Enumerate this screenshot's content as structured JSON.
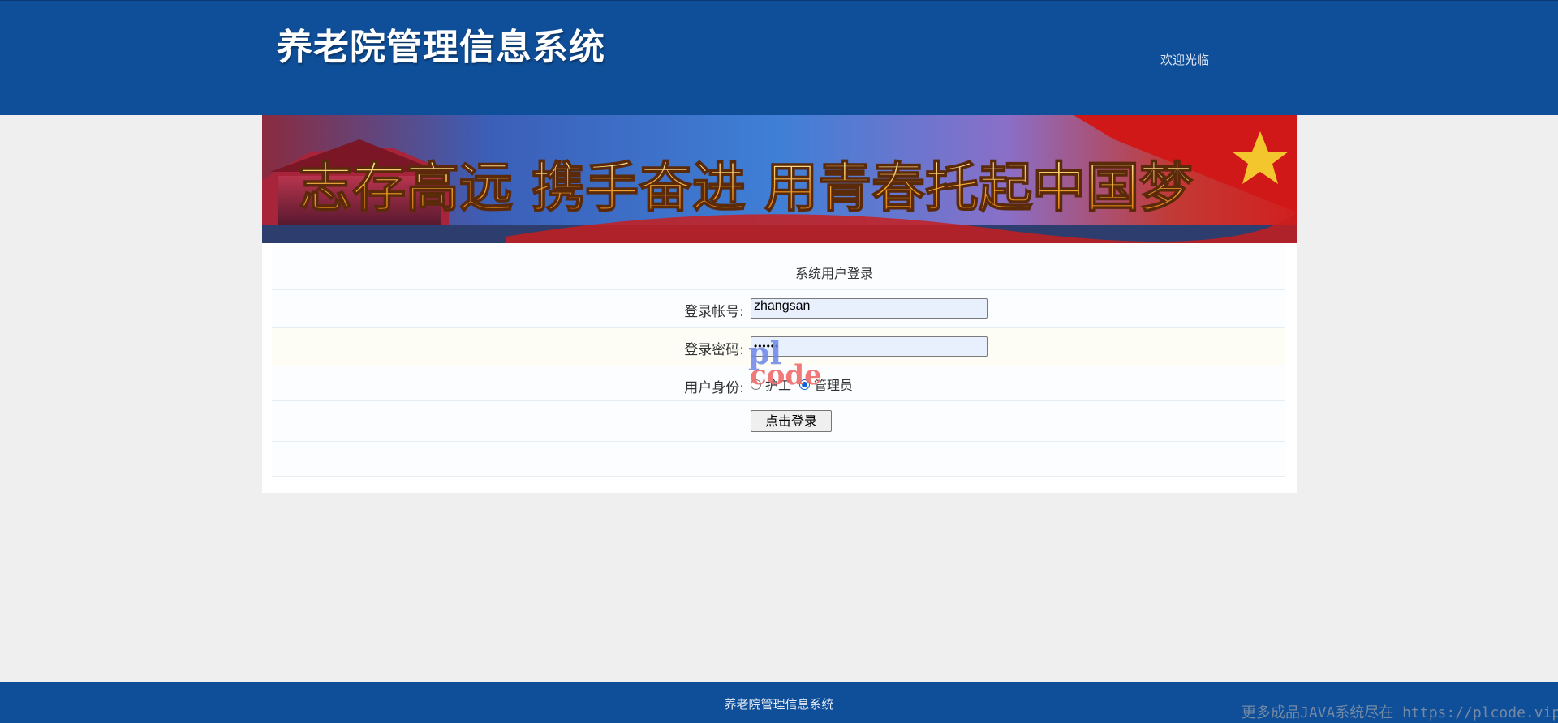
{
  "header": {
    "title": "养老院管理信息系统",
    "welcome": "欢迎光临"
  },
  "banner": {
    "slogan": "志存高远  携手奋进  用青春托起中国梦"
  },
  "login_form": {
    "heading": "系统用户登录",
    "account_label": "登录帐号:",
    "account_value": "zhangsan",
    "password_label": "登录密码:",
    "password_value": "••••••",
    "role_label": "用户身份:",
    "roles": [
      {
        "label": "护工",
        "checked": false
      },
      {
        "label": "管理员",
        "checked": true
      }
    ],
    "submit_label": "点击登录"
  },
  "footer": {
    "text": "养老院管理信息系统"
  },
  "watermark": {
    "logo_top": "pl",
    "logo_bottom": "code",
    "text": "更多成品JAVA系统尽在 https://plcode.vip"
  },
  "colors": {
    "header_bg": "#0f4e98",
    "page_bg": "#efefef",
    "radio_accent": "#0f62d6"
  }
}
